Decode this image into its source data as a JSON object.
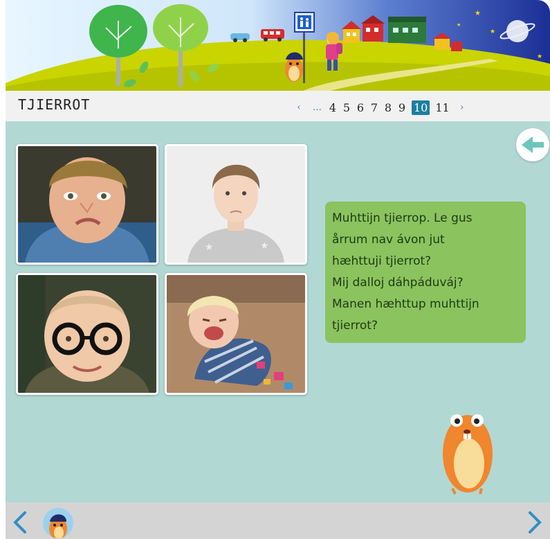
{
  "header": {
    "title": "TJIERROT",
    "sign_icon": "pedestrian-crossing-sign-icon"
  },
  "pagination": {
    "prev_icon": "chevron-left-icon",
    "ellipsis": "…",
    "pages": [
      "4",
      "5",
      "6",
      "7",
      "8",
      "9",
      "10",
      "11"
    ],
    "current": "10",
    "next_icon": "chevron-right-icon"
  },
  "content": {
    "back_icon": "arrow-left-icon",
    "photos": [
      {
        "subject": "crying-boy"
      },
      {
        "subject": "sad-girl"
      },
      {
        "subject": "smiling-baby-with-glasses"
      },
      {
        "subject": "crying-toddler"
      }
    ],
    "bubble_text": "Muhttijn tjierrop. Le gus\nårrum nav ávon jut\nhæhttuji tjierrot?\nMij dalloj dáhpáduváj?\nManen hæhttup muhttijn\ntjierrot?"
  },
  "footer": {
    "prev_icon": "chevron-left-icon",
    "next_icon": "chevron-right-icon",
    "avatar_icon": "hamster-avatar-icon"
  },
  "colors": {
    "content_bg": "#b2d8d4",
    "bubble": "#8bc35f",
    "accent": "#1c7fa1",
    "footer_bg": "#d4d4d4"
  }
}
